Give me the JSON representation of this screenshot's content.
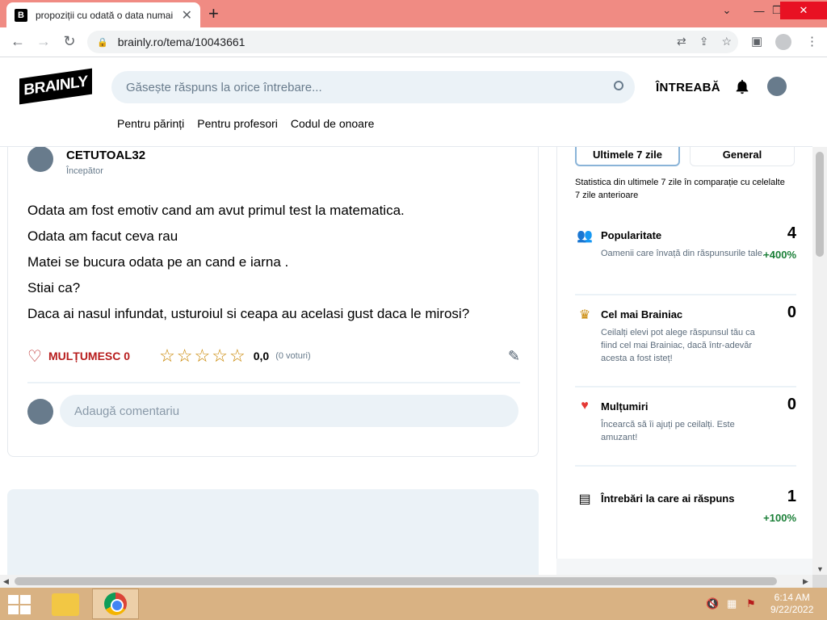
{
  "browser": {
    "tab_title": "propoziții cu odată o data numai",
    "tab_close": "✕",
    "new_tab": "+",
    "url": "brainly.ro/tema/10043661"
  },
  "header": {
    "logo": "BRAINLY",
    "search_placeholder": "Găsește răspuns la orice întrebare...",
    "ask_label": "ÎNTREABĂ",
    "nav": [
      "Pentru părinți",
      "Pentru profesori",
      "Codul de onoare"
    ]
  },
  "answer": {
    "username": "CETUTOAL32",
    "rank": "Începător",
    "lines": [
      "Odata am fost emotiv cand am avut primul test la matematica.",
      "Odata am facut ceva rau",
      "Matei se bucura odata pe an cand e iarna .",
      "Stiai ca?",
      "Daca ai nasul infundat, usturoiul si ceapa au acelasi gust daca le mirosi?"
    ],
    "thanks_label": "MULȚUMESC 0",
    "rating_value": "0,0",
    "votes": "(0 voturi)",
    "comment_placeholder": "Adaugă comentariu"
  },
  "sidebar": {
    "tab_active": "Ultimele 7 zile",
    "tab_inactive": "General",
    "description": "Statistica din ultimele 7 zile în comparație cu celelalte 7 zile anterioare",
    "stats": [
      {
        "icon": "people-icon",
        "title": "Popularitate",
        "value": "4",
        "description": "Oamenii care învață din răspunsurile tale.",
        "change": "+400%"
      },
      {
        "icon": "crown-icon",
        "title": "Cel mai Brainiac",
        "value": "0",
        "description": "Ceilalți elevi pot alege răspunsul tău ca fiind cel mai Brainiac, dacă într-adevăr acesta a fost isteț!",
        "change": ""
      },
      {
        "icon": "heart-icon",
        "title": "Mulțumiri",
        "value": "0",
        "description": "Încearcă să îi ajuți pe ceilalți. Este amuzant!",
        "change": ""
      },
      {
        "icon": "list-icon",
        "title": "Întrebări la care ai răspuns",
        "value": "1",
        "description": "",
        "change": "+100%"
      }
    ]
  },
  "taskbar": {
    "time": "6:14 AM",
    "date": "9/22/2022"
  },
  "colors": {
    "tab_strip": "#f08b83",
    "thanks_red": "#b71c1c",
    "star_gold": "#c98600",
    "positive_green": "#1a7f37",
    "taskbar": "#d9b283"
  }
}
